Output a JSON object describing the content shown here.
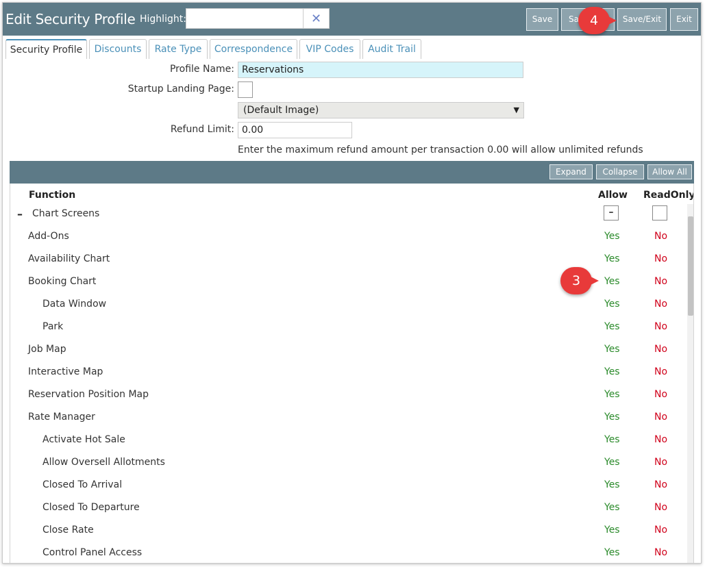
{
  "header": {
    "title": "Edit Security Profile",
    "highlight_label": "Highlight:",
    "highlight_value": "",
    "clear_glyph": "✕",
    "buttons": {
      "save": "Save",
      "save_new": "Sa",
      "save_exit": "Save/Exit",
      "exit": "Exit"
    }
  },
  "tabs": [
    "Security Profile",
    "Discounts",
    "Rate Type",
    "Correspondence",
    "VIP Codes",
    "Audit Trail"
  ],
  "form": {
    "profile_name_label": "Profile Name:",
    "profile_name_value": "Reservations",
    "startup_label": "Startup Landing Page:",
    "image_select_value": "(Default Image)",
    "refund_label": "Refund Limit:",
    "refund_value": "0.00",
    "refund_hint": "Enter the maximum refund amount per transaction 0.00 will allow unlimited refunds"
  },
  "grid_toolbar": {
    "expand": "Expand",
    "collapse": "Collapse",
    "allow_all": "Allow All"
  },
  "grid": {
    "col_function": "Function",
    "col_allow": "Allow",
    "col_readonly": "ReadOnly",
    "group_label": "Chart Screens",
    "group_toggle": "–",
    "rows": [
      {
        "name": "Add-Ons",
        "indent": 0,
        "allow": "Yes",
        "readonly": "No"
      },
      {
        "name": "Availability Chart",
        "indent": 0,
        "allow": "Yes",
        "readonly": "No"
      },
      {
        "name": "Booking Chart",
        "indent": 0,
        "allow": "Yes",
        "readonly": "No"
      },
      {
        "name": "Data Window",
        "indent": 1,
        "allow": "Yes",
        "readonly": "No"
      },
      {
        "name": "Park",
        "indent": 1,
        "allow": "Yes",
        "readonly": "No"
      },
      {
        "name": "Job Map",
        "indent": 0,
        "allow": "Yes",
        "readonly": "No"
      },
      {
        "name": "Interactive Map",
        "indent": 0,
        "allow": "Yes",
        "readonly": "No"
      },
      {
        "name": "Reservation Position Map",
        "indent": 0,
        "allow": "Yes",
        "readonly": "No"
      },
      {
        "name": "Rate Manager",
        "indent": 0,
        "allow": "Yes",
        "readonly": "No"
      },
      {
        "name": "Activate Hot Sale",
        "indent": 1,
        "allow": "Yes",
        "readonly": "No"
      },
      {
        "name": "Allow Oversell Allotments",
        "indent": 1,
        "allow": "Yes",
        "readonly": "No"
      },
      {
        "name": "Closed To Arrival",
        "indent": 1,
        "allow": "Yes",
        "readonly": "No"
      },
      {
        "name": "Closed To Departure",
        "indent": 1,
        "allow": "Yes",
        "readonly": "No"
      },
      {
        "name": "Close Rate",
        "indent": 1,
        "allow": "Yes",
        "readonly": "No"
      },
      {
        "name": "Control Panel Access",
        "indent": 1,
        "allow": "Yes",
        "readonly": "No"
      }
    ]
  },
  "callouts": {
    "step3": "3",
    "step4": "4"
  },
  "colors": {
    "header": "#5d7a87",
    "button": "#8da3ad",
    "yes": "#2a8a2a",
    "no": "#d0021b",
    "badge": "#e83a3a"
  }
}
